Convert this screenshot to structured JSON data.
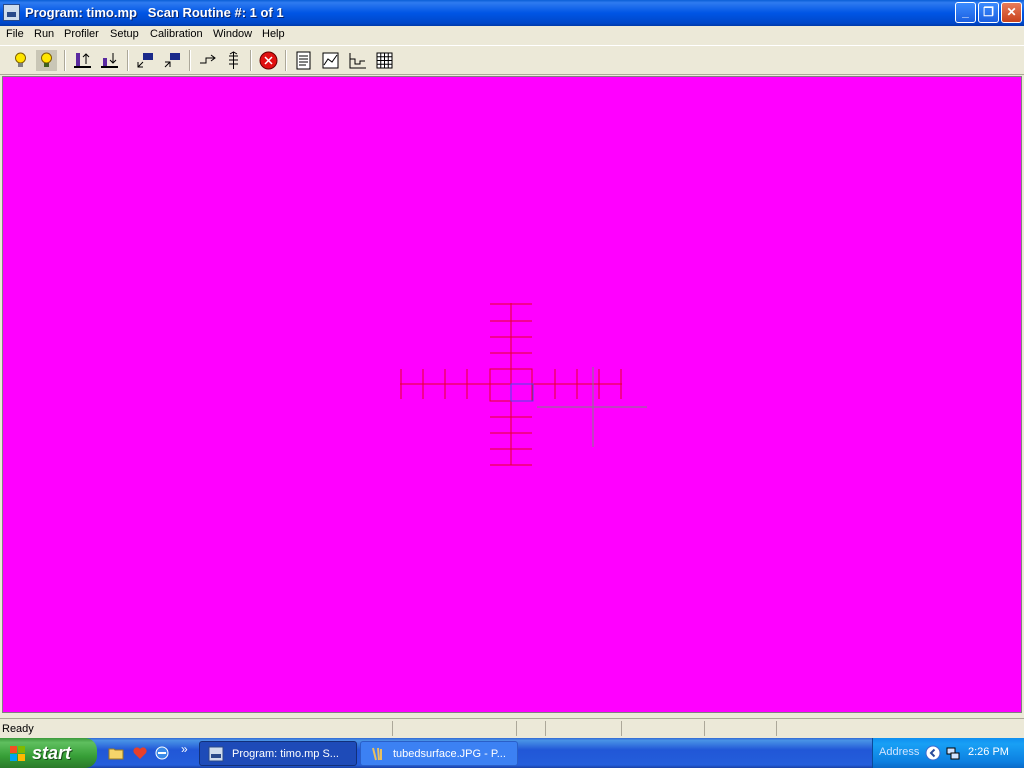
{
  "window": {
    "title": "Program: timo.mp   Scan Routine #: 1 of 1",
    "minimize_glyph": "_",
    "restore_glyph": "❐",
    "close_glyph": "✕"
  },
  "menu": [
    "File",
    "Run",
    "Profiler",
    "Setup",
    "Calibration",
    "Window",
    "Help"
  ],
  "toolbar": {
    "icons": [
      "lightbulb-on-icon",
      "lightbulb-off-icon",
      "probe-up-icon",
      "probe-down-icon",
      "move-to-icon",
      "move-from-icon",
      "step-icon",
      "scan-stack-icon",
      "stop-icon",
      "report-icon",
      "profile-graph-icon",
      "step-graph-icon",
      "grid-icon"
    ]
  },
  "canvas": {
    "background": "#ff00ff",
    "crosshair_color": "#e8002a",
    "cursor_box_color": "#4a4ae0",
    "probe_marker_color": "#808080"
  },
  "status": {
    "text": "Ready"
  },
  "taskbar": {
    "start_label": "start",
    "overflow_glyph": "»",
    "tasks": [
      {
        "label": "Program: timo.mp   S...",
        "active": true
      },
      {
        "label": "tubedsurface.JPG - P...",
        "active": false
      }
    ],
    "address_label": "Address",
    "clock": "2:26 PM"
  },
  "colors": {
    "title_bar": "#0055e5",
    "chrome": "#ece9d8",
    "taskbar": "#245edb",
    "start": "#379f37"
  }
}
